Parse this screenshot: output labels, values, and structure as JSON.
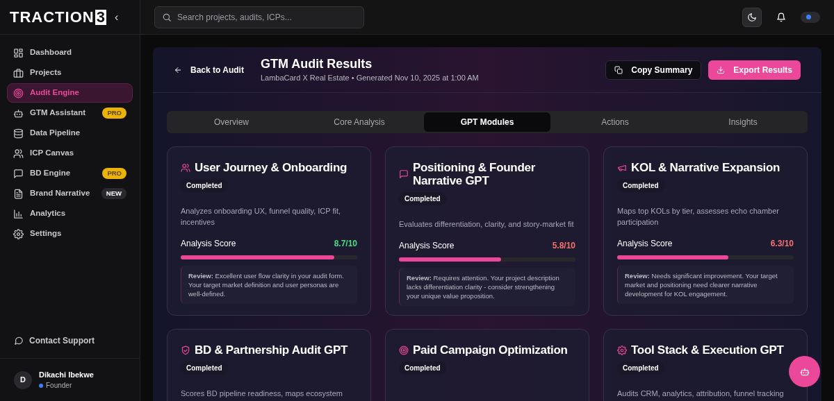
{
  "sidebar": {
    "logo": "TRACTION",
    "logo_mark": "3",
    "collapse": "‹",
    "items": [
      {
        "kind": "grid",
        "label": "Dashboard",
        "selected": false
      },
      {
        "kind": "briefcase",
        "label": "Projects",
        "selected": false
      },
      {
        "kind": "target",
        "label": "Audit Engine",
        "selected": true
      },
      {
        "kind": "bot",
        "label": "GTM Assistant",
        "selected": false,
        "badge": {
          "text": "PRO",
          "kind": "pro"
        }
      },
      {
        "kind": "database",
        "label": "Data Pipeline",
        "selected": false
      },
      {
        "kind": "users",
        "label": "ICP Canvas",
        "selected": false
      },
      {
        "kind": "chat",
        "label": "BD Engine",
        "selected": false,
        "badge": {
          "text": "PRO",
          "kind": "pro"
        }
      },
      {
        "kind": "doc",
        "label": "Brand Narrative",
        "selected": false,
        "badge": {
          "text": "NEW",
          "kind": "new"
        }
      },
      {
        "kind": "chart",
        "label": "Analytics",
        "selected": false
      },
      {
        "kind": "gear",
        "label": "Settings",
        "selected": false
      }
    ],
    "support": "Contact Support",
    "user": {
      "initial": "D",
      "name": "Dikachi Ibekwe",
      "role": "Founder"
    }
  },
  "topbar": {
    "search": {
      "placeholder": "Search projects, audits, ICPs..."
    },
    "toggle": {
      "on": true
    }
  },
  "header": {
    "back": "Back to Audit",
    "title": "GTM Audit Results",
    "subtitle": "LambaCard X Real Estate • Generated Nov 10, 2025 at 1:00 AM",
    "buttons": [
      {
        "kind": "copy",
        "label": "Copy Summary"
      },
      {
        "kind": "export",
        "label": "Export Results"
      }
    ]
  },
  "tabs": [
    {
      "label": "Overview",
      "selected": false
    },
    {
      "label": "Core Analysis",
      "selected": false
    },
    {
      "label": "GPT Modules",
      "selected": true
    },
    {
      "label": "Actions",
      "selected": false
    },
    {
      "label": "Insights",
      "selected": false
    }
  ],
  "modules": [
    {
      "kind": "users",
      "title": "User Journey & Onboarding",
      "status": "Completed",
      "description": "Analyzes onboarding UX, funnel quality, ICP fit, incentives",
      "score_label": "Analysis Score",
      "score": "8.7/10",
      "color": "#4ade80",
      "level": 0.87,
      "review": "**Review:** Excellent user flow clarity in your audit form. Your target market definition and user personas are well-defined."
    },
    {
      "kind": "chat",
      "title": "Positioning & Founder Narrative GPT",
      "status": "Completed",
      "description": "Evaluates differentiation, clarity, and story-market fit",
      "score_label": "Analysis Score",
      "score": "5.8/10",
      "color": "#f87171",
      "level": 0.58,
      "review": "**Review:** Requires attention. Your project description lacks differentiation clarity - consider strengthening your unique value proposition."
    },
    {
      "kind": "megaphone",
      "title": "KOL & Narrative Expansion",
      "status": "Completed",
      "description": "Maps top KOLs by tier, assesses echo chamber participation",
      "score_label": "Analysis Score",
      "score": "6.3/10",
      "color": "#f87171",
      "level": 0.63,
      "review": "**Review:** Needs significant improvement. Your target market and positioning need clearer narrative development for KOL engagement."
    },
    {
      "kind": "shield",
      "title": "BD & Partnership Audit GPT",
      "status": "Completed",
      "description": "Scores BD pipeline readiness, maps ecosystem"
    },
    {
      "kind": "target",
      "title": "Paid Campaign Optimization",
      "status": "Completed"
    },
    {
      "kind": "gear",
      "title": "Tool Stack & Execution GPT",
      "status": "Completed",
      "description": "Audits CRM, analytics, attribution, funnel tracking"
    }
  ]
}
